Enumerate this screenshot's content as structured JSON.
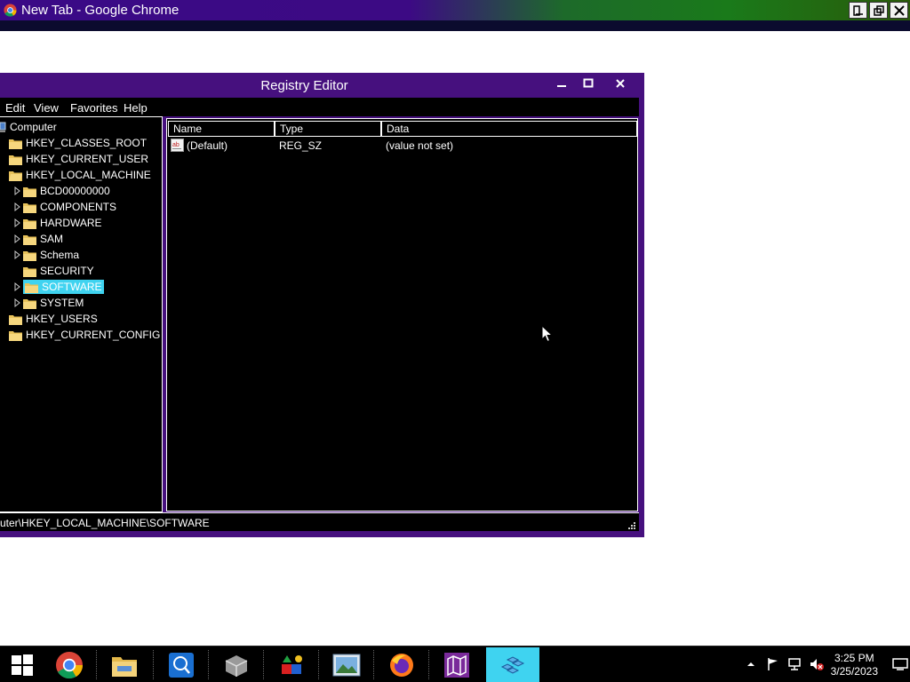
{
  "chrome": {
    "title": "New Tab - Google Chrome"
  },
  "regedit": {
    "title": "Registry Editor",
    "menu": [
      "Edit",
      "View",
      "Favorites",
      "Help"
    ],
    "tree": {
      "root": "Computer",
      "hives": [
        "HKEY_CLASSES_ROOT",
        "HKEY_CURRENT_USER",
        "HKEY_LOCAL_MACHINE"
      ],
      "hklm_children": [
        "BCD00000000",
        "COMPONENTS",
        "HARDWARE",
        "SAM",
        "Schema",
        "SECURITY",
        "SOFTWARE",
        "SYSTEM"
      ],
      "after": [
        "HKEY_USERS",
        "HKEY_CURRENT_CONFIG"
      ],
      "selected": "SOFTWARE"
    },
    "columns": [
      "Name",
      "Type",
      "Data"
    ],
    "values": [
      {
        "name": "(Default)",
        "type": "REG_SZ",
        "data": "(value not set)"
      }
    ],
    "status_path": "uter\\HKEY_LOCAL_MACHINE\\SOFTWARE"
  },
  "taskbar": {
    "apps": [
      "start-icon",
      "chrome-icon",
      "file-explorer-icon",
      "network-search-icon",
      "drive-icon",
      "apps-shapes-icon",
      "photos-icon",
      "firefox-icon",
      "maps-icon",
      "registry-editor-icon"
    ],
    "clock_time": "3:25 PM",
    "clock_date": "3/25/2023"
  },
  "colors": {
    "window_frame": "#46107e",
    "selection": "#3fd3f0",
    "background": "#000000"
  }
}
